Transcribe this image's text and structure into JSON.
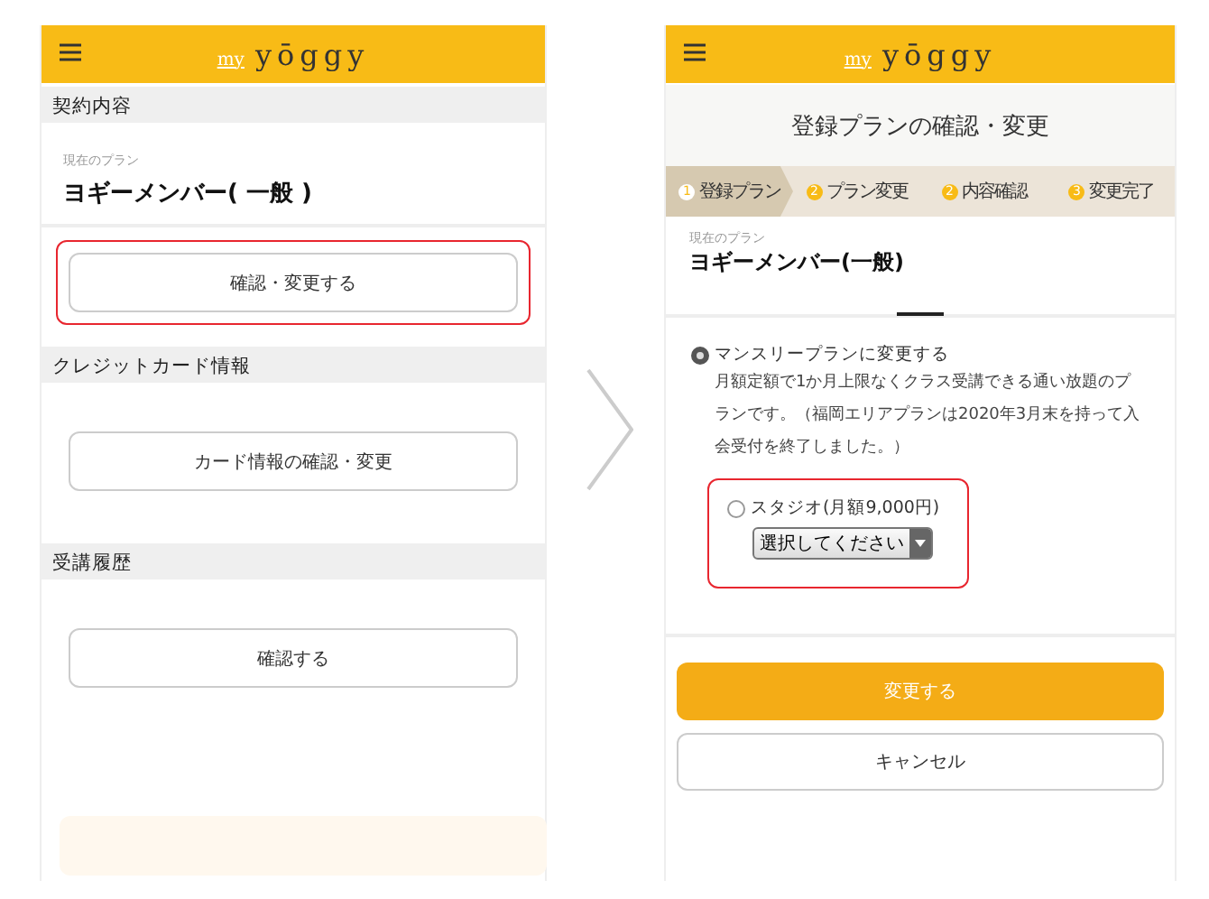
{
  "left_screen": {
    "header": {
      "logo_prefix": "my",
      "logo": "yōggy"
    },
    "sections": [
      {
        "kind": "plan",
        "title": "契約内容",
        "plan_label": "現在のプラン",
        "plan_name": "ヨギーメンバー( 一般 )",
        "button": "確認・変更する",
        "highlighted": true
      },
      {
        "kind": "button",
        "title": "クレジットカード情報",
        "button": "カード情報の確認・変更",
        "highlighted": false
      },
      {
        "kind": "button",
        "title": "受講履歴",
        "button": "確認する",
        "highlighted": false
      }
    ],
    "faded_button": true
  },
  "right_screen": {
    "header": {
      "logo_prefix": "my",
      "logo": "yōggy"
    },
    "page_title": "登録プランの確認・変更",
    "steps": [
      {
        "number": "1",
        "label": "登録プラン",
        "selected": true
      },
      {
        "number": "2",
        "label": "プラン変更",
        "selected": false
      },
      {
        "number": "2",
        "label": "内容確認",
        "selected": false
      },
      {
        "number": "3",
        "label": "変更完了",
        "selected": false
      }
    ],
    "plan_label": "現在のプラン",
    "plan_name": "ヨギーメンバー(一般)",
    "option": {
      "label": "マンスリープランに変更する",
      "checked": true,
      "description": "月額定額で1か月上限なくクラス受講できる通い放題のプランです。（福岡エリアプランは2020年3月末を持って入会受付を終了しました。）"
    },
    "sub_option": {
      "label": "スタジオ(月額9,000円)",
      "checked": false,
      "select": "選択してください",
      "highlighted": true
    },
    "submit": "変更する",
    "cancel": "キャンセル"
  }
}
